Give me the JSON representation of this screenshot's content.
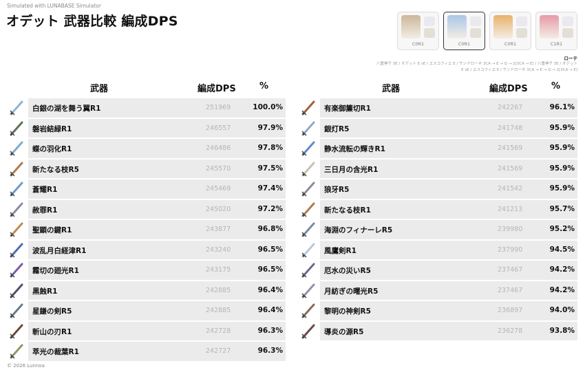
{
  "header": {
    "credit": "Simulated with LUNABASE Simulator",
    "title": "オデット 武器比較 編成DPS",
    "copyright": "© 2026 Lunnoa"
  },
  "team": [
    {
      "const": "C0R1",
      "active": false,
      "color": "#cbb79a"
    },
    {
      "const": "C0R1",
      "active": true,
      "color": "#a9c6e8"
    },
    {
      "const": "C0R1",
      "active": false,
      "color": "#e8b26a"
    },
    {
      "const": "C1R1",
      "active": false,
      "color": "#e69aa8"
    }
  ],
  "rotation": {
    "label": "ローテ",
    "line1": "八重神子 3E / オデット E sE / エスコフィエ E / サンドローネ 3CA → E → Q → 2[3CA → E] / 八重神子 3E / オデット",
    "line2": "E sE / エスコフィエ E / サンドローネ 3CA → E → Q → 2[3CA → E]"
  },
  "columns": {
    "weapon": "武器",
    "dps": "編成DPS",
    "pct": "%"
  },
  "left_rows": [
    {
      "name": "白銀の湖を舞う翼R1",
      "dps": "251969",
      "pct": "100.0%",
      "icon": "#8fb3d9"
    },
    {
      "name": "磐岩結緑R1",
      "dps": "246557",
      "pct": "97.9%",
      "icon": "#5f6f5a"
    },
    {
      "name": "蝶の羽化R1",
      "dps": "246486",
      "pct": "97.8%",
      "icon": "#7fa9c9"
    },
    {
      "name": "新たなる枝R5",
      "dps": "245570",
      "pct": "97.5%",
      "icon": "#b07a4a"
    },
    {
      "name": "蒼耀R1",
      "dps": "245469",
      "pct": "97.4%",
      "icon": "#6b9bd1"
    },
    {
      "name": "赦罪R1",
      "dps": "245020",
      "pct": "97.2%",
      "icon": "#8a8aa0"
    },
    {
      "name": "聖顕の鍵R1",
      "dps": "243877",
      "pct": "96.8%",
      "icon": "#c08a4a"
    },
    {
      "name": "波乱月白経津R1",
      "dps": "243240",
      "pct": "96.5%",
      "icon": "#4a6fb0"
    },
    {
      "name": "霧切の廻光R1",
      "dps": "243175",
      "pct": "96.5%",
      "icon": "#7a5aa8"
    },
    {
      "name": "黒蝕R1",
      "dps": "242885",
      "pct": "96.4%",
      "icon": "#5a4a6a"
    },
    {
      "name": "星鎌の剣R5",
      "dps": "242885",
      "pct": "96.4%",
      "icon": "#6a7a8a"
    },
    {
      "name": "斬山の刃R1",
      "dps": "242728",
      "pct": "96.3%",
      "icon": "#6a4a3a"
    },
    {
      "name": "萃光の裁葉R1",
      "dps": "242727",
      "pct": "96.3%",
      "icon": "#8a9a6a"
    }
  ],
  "right_rows": [
    {
      "name": "有楽御簾切R1",
      "dps": "242267",
      "pct": "96.1%",
      "icon": "#a0603a"
    },
    {
      "name": "銀灯R5",
      "dps": "241748",
      "pct": "95.9%",
      "icon": "#8fa8c8"
    },
    {
      "name": "静水流転の輝きR1",
      "dps": "241569",
      "pct": "95.9%",
      "icon": "#5a8ad0"
    },
    {
      "name": "三日月の含光R1",
      "dps": "241569",
      "pct": "95.9%",
      "icon": "#c8c0b0"
    },
    {
      "name": "狼牙R5",
      "dps": "241542",
      "pct": "95.9%",
      "icon": "#8a8a9a"
    },
    {
      "name": "新たなる枝R1",
      "dps": "241213",
      "pct": "95.7%",
      "icon": "#b07a4a"
    },
    {
      "name": "海淵のフィナーレR5",
      "dps": "239980",
      "pct": "95.2%",
      "icon": "#7a8aa0"
    },
    {
      "name": "風鷹剣R1",
      "dps": "237990",
      "pct": "94.5%",
      "icon": "#b8c8d8"
    },
    {
      "name": "厄水の災いR5",
      "dps": "237467",
      "pct": "94.2%",
      "icon": "#6a6a8a"
    },
    {
      "name": "月紡ぎの曙光R5",
      "dps": "237467",
      "pct": "94.2%",
      "icon": "#9a8ab0"
    },
    {
      "name": "黎明の神剣R5",
      "dps": "236897",
      "pct": "94.0%",
      "icon": "#8a6a5a"
    },
    {
      "name": "導炎の源R5",
      "dps": "236278",
      "pct": "93.8%",
      "icon": "#6a4a4a"
    }
  ]
}
